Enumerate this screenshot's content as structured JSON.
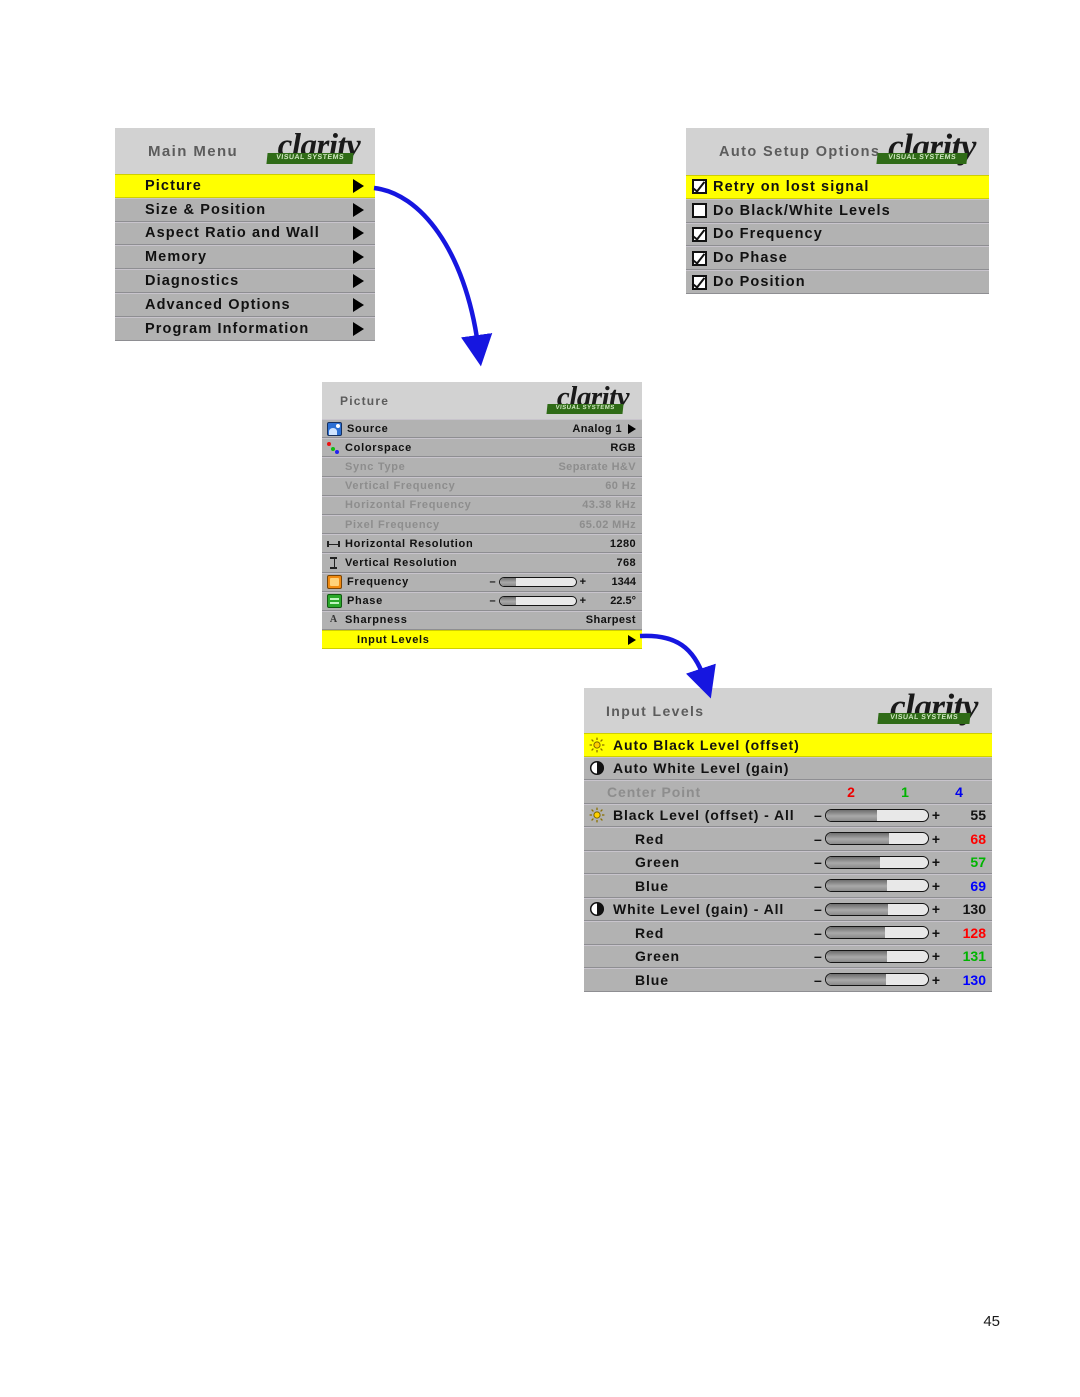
{
  "page": {
    "number": "45"
  },
  "brand": {
    "word": "clarity",
    "tagline": "VISUAL SYSTEMS"
  },
  "main_menu": {
    "title": "Main Menu",
    "items": [
      {
        "label": "Picture",
        "selected": true,
        "arrow": true
      },
      {
        "label": "Size & Position",
        "selected": false,
        "arrow": true
      },
      {
        "label": "Aspect Ratio and Wall",
        "selected": false,
        "arrow": true
      },
      {
        "label": "Memory",
        "selected": false,
        "arrow": true
      },
      {
        "label": "Diagnostics",
        "selected": false,
        "arrow": true
      },
      {
        "label": "Advanced Options",
        "selected": false,
        "arrow": true
      },
      {
        "label": "Program Information",
        "selected": false,
        "arrow": true
      }
    ]
  },
  "auto_setup": {
    "title": "Auto Setup Options",
    "items": [
      {
        "label": "Retry on lost signal",
        "checked": true,
        "selected": true
      },
      {
        "label": "Do Black/White Levels",
        "checked": false,
        "selected": false
      },
      {
        "label": "Do Frequency",
        "checked": true,
        "selected": false
      },
      {
        "label": "Do Phase",
        "checked": true,
        "selected": false
      },
      {
        "label": "Do Position",
        "checked": true,
        "selected": false
      }
    ]
  },
  "picture": {
    "title": "Picture",
    "rows": [
      {
        "icon": "source-icon",
        "label": "Source",
        "value": "Analog 1",
        "arrow": true,
        "dim": false
      },
      {
        "icon": "colorspace-icon",
        "label": "Colorspace",
        "value": "RGB",
        "arrow": false,
        "dim": false
      },
      {
        "icon": "none",
        "label": "Sync Type",
        "value": "Separate H&V",
        "arrow": false,
        "dim": true
      },
      {
        "icon": "none",
        "label": "Vertical Frequency",
        "value": "60 Hz",
        "arrow": false,
        "dim": true
      },
      {
        "icon": "none",
        "label": "Horizontal Frequency",
        "value": "43.38 kHz",
        "arrow": false,
        "dim": true
      },
      {
        "icon": "none",
        "label": "Pixel Frequency",
        "value": "65.02 MHz",
        "arrow": false,
        "dim": true
      },
      {
        "icon": "hres-icon",
        "label": "Horizontal Resolution",
        "value": "1280",
        "arrow": false,
        "dim": false
      },
      {
        "icon": "vres-icon",
        "label": "Vertical Resolution",
        "value": "768",
        "arrow": false,
        "dim": false
      },
      {
        "icon": "frequency-icon",
        "label": "Frequency",
        "value": "1344",
        "slider": 22,
        "dim": false
      },
      {
        "icon": "phase-icon",
        "label": "Phase",
        "value": "22.5°",
        "slider": 22,
        "dim": false
      },
      {
        "icon": "sharpness-icon",
        "label": "Sharpness",
        "value": "Sharpest",
        "arrow": false,
        "dim": false
      },
      {
        "icon": "none",
        "label": "Input Levels",
        "value": "",
        "arrow": true,
        "selected": true
      }
    ]
  },
  "input_levels": {
    "title": "Input Levels",
    "rows": [
      {
        "icon": "sun-icon",
        "label": "Auto Black Level (offset)",
        "kind": "action",
        "selected": true
      },
      {
        "icon": "contrast-icon",
        "label": "Auto White Level (gain)",
        "kind": "action",
        "selected": false
      },
      {
        "icon": "none",
        "label": "Center Point",
        "kind": "centerpoint",
        "dim": true,
        "center_point": {
          "red": "2",
          "green": "1",
          "blue": "4"
        }
      },
      {
        "icon": "sun-icon",
        "label": "Black Level (offset) - All",
        "kind": "slider",
        "slider": 50,
        "value": "55",
        "value_color": "#111111"
      },
      {
        "icon": "none",
        "label": "Red",
        "kind": "slider",
        "indent": true,
        "slider": 62,
        "value": "68",
        "value_color": "#ff0000"
      },
      {
        "icon": "none",
        "label": "Green",
        "kind": "slider",
        "indent": true,
        "slider": 53,
        "value": "57",
        "value_color": "#00b400"
      },
      {
        "icon": "none",
        "label": "Blue",
        "kind": "slider",
        "indent": true,
        "slider": 60,
        "value": "69",
        "value_color": "#0000ff"
      },
      {
        "icon": "contrast-icon",
        "label": "White Level (gain) - All",
        "kind": "slider",
        "slider": 61,
        "value": "130",
        "value_color": "#111111"
      },
      {
        "icon": "none",
        "label": "Red",
        "kind": "slider",
        "indent": true,
        "slider": 58,
        "value": "128",
        "value_color": "#ff0000"
      },
      {
        "icon": "none",
        "label": "Green",
        "kind": "slider",
        "indent": true,
        "slider": 60,
        "value": "131",
        "value_color": "#00b400"
      },
      {
        "icon": "none",
        "label": "Blue",
        "kind": "slider",
        "indent": true,
        "slider": 59,
        "value": "130",
        "value_color": "#0000ff"
      }
    ]
  },
  "colors": {
    "highlight": "#ffff00",
    "panel_bg": "#b2b2b2",
    "header_bg": "#d2d2d2",
    "arrow_blue": "#1616e0",
    "logo_green": "#2f6b17"
  },
  "slider_glyphs": {
    "minus": "–",
    "plus": "+"
  }
}
